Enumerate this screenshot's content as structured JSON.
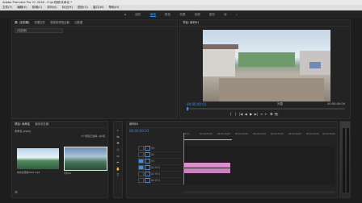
{
  "app": {
    "title": "Adobe Premiere Pro CC 2018 - E:\\pr视频\\未命名 *"
  },
  "menu": [
    "文件(F)",
    "编辑(E)",
    "剪辑(C)",
    "序列(S)",
    "标记(M)",
    "图形(G)",
    "窗口(W)",
    "帮助(H)"
  ],
  "workspaces": [
    "组件",
    "编辑",
    "颜色",
    "效果",
    "音频",
    "图形",
    "库"
  ],
  "source_panel": {
    "tabs": [
      "源: (无剪辑)",
      "效果控件",
      "音频剪辑混合器",
      "元数据"
    ],
    "field_text": "(无剪辑)"
  },
  "program_monitor": {
    "tab": "节目: 序列01",
    "timecode": "00:00:00:01",
    "fit_label": "完整",
    "duration": "00:00:40:00",
    "controls": [
      "{",
      "}",
      "|◀",
      "◀",
      "▶",
      "▶|",
      "⇥",
      "⇤",
      "⧉",
      "📷"
    ]
  },
  "project_panel": {
    "tabs": [
      "项目: 未命名",
      "媒体浏览器"
    ],
    "path": "未命名.prproj",
    "item_count": "1个项目已选择, 共2项",
    "items": [
      {
        "name": "未命名视频2016.mp4",
        "duration": "40:00"
      },
      {
        "name": "序列01",
        "duration": "40:00"
      }
    ]
  },
  "timeline": {
    "tab": "序列01",
    "timecode": "00:00:00:01",
    "ruler": [
      "00:00",
      "00:00:05:00",
      "00:00:10:00",
      "00:00:15:00",
      "00:00:20:00",
      "00:00:25:00",
      "00:00:30:00",
      "00:00:35:00",
      "00:00:40:00"
    ],
    "video_tracks": [
      "V3",
      "V2",
      "V1"
    ],
    "audio_tracks": [
      "A1",
      "A2",
      "A3"
    ],
    "colors": {
      "video_clip": "#8a7bd0",
      "audio_clip": "#e08ad0",
      "playhead": "#3d8de4"
    }
  },
  "tools": [
    "▸",
    "⇆",
    "✥",
    "◇",
    "⇔",
    "✒",
    "✋",
    "T"
  ]
}
